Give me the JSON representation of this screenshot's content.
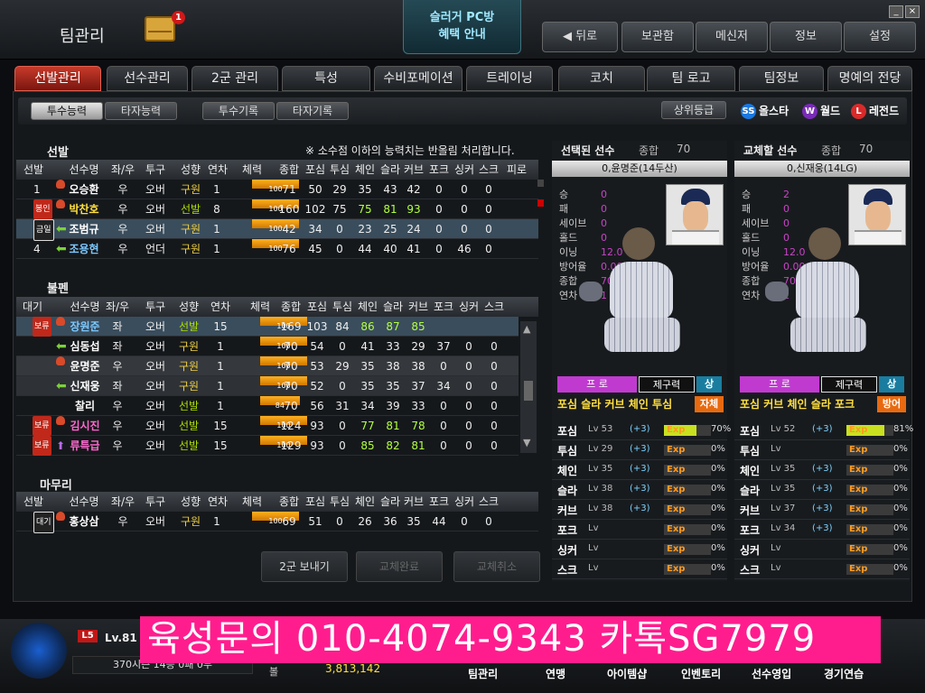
{
  "header": {
    "title": "팀관리",
    "mail_count": "1",
    "pcbang": [
      "슬러거 PC방",
      "혜택 안내"
    ],
    "nav": [
      "뒤로",
      "보관함",
      "메신저",
      "정보",
      "설정"
    ]
  },
  "tabs": [
    "선발관리",
    "선수관리",
    "2군 관리",
    "특성",
    "수비포메이션",
    "트레이닝",
    "코치",
    "팀 로고",
    "팀정보",
    "명예의 전당"
  ],
  "subtabs": [
    "투수능력",
    "타자능력",
    "투수기록",
    "타자기록"
  ],
  "grade": {
    "label": "상위등급",
    "items": [
      {
        "icon": "SS",
        "label": "올스타",
        "color": "#1a78e0"
      },
      {
        "icon": "W",
        "label": "월드",
        "color": "#7a2ab8"
      },
      {
        "icon": "L",
        "label": "레전드",
        "color": "#d82a2a"
      }
    ]
  },
  "notice": "※ 소수점 이하의 능력치는 반올림 처리합니다.",
  "sections": {
    "starter": "선발",
    "bullpen": "불펜",
    "closer": "마무리"
  },
  "starter_header": [
    "선발",
    "선수명",
    "좌/우",
    "투구",
    "성향",
    "연차",
    "체력",
    "종합",
    "포심",
    "투심",
    "체인",
    "슬라",
    "커브",
    "포크",
    "싱커",
    "스크",
    "피로"
  ],
  "starter_rows": [
    {
      "slot": "1",
      "name": "오승환",
      "hand": "우",
      "style": "오버",
      "type": "구원",
      "year": "1",
      "stamina": "100",
      "vals": [
        "71",
        "50",
        "29",
        "35",
        "43",
        "42",
        "0",
        "0",
        "0"
      ],
      "name_color": "#ffffff"
    },
    {
      "slot": "봉인",
      "name": "박찬호",
      "hand": "우",
      "style": "오버",
      "type": "선발",
      "year": "8",
      "stamina": "100",
      "vals": [
        "160",
        "102",
        "75",
        "75",
        "81",
        "93",
        "0",
        "0",
        "0"
      ],
      "name_color": "#ffe040"
    },
    {
      "slot": "금일",
      "name": "조범규",
      "hand": "우",
      "style": "오버",
      "type": "구원",
      "year": "1",
      "stamina": "100",
      "vals": [
        "42",
        "34",
        "0",
        "23",
        "25",
        "24",
        "0",
        "0",
        "0"
      ],
      "name_color": "#ffffff"
    },
    {
      "slot": "4",
      "name": "조용현",
      "hand": "우",
      "style": "언더",
      "type": "구원",
      "year": "1",
      "stamina": "100",
      "vals": [
        "76",
        "45",
        "0",
        "44",
        "40",
        "41",
        "0",
        "46",
        "0"
      ],
      "name_color": "#7cc8ff"
    }
  ],
  "bullpen_header": [
    "대기",
    "선수명",
    "좌/우",
    "투구",
    "성향",
    "연차",
    "체력",
    "종합",
    "포심",
    "투심",
    "체인",
    "슬라",
    "커브",
    "포크",
    "싱커",
    "스크"
  ],
  "bullpen_rows": [
    {
      "tag": "보류",
      "name": "장원준",
      "hand": "좌",
      "style": "오버",
      "type": "선발",
      "year": "15",
      "stamina": "100",
      "vals": [
        "169",
        "103",
        "84",
        "86",
        "87",
        "85",
        "",
        "",
        ""
      ],
      "name_color": "#7cc8ff"
    },
    {
      "tag": "",
      "name": "심동섭",
      "hand": "좌",
      "style": "오버",
      "type": "구원",
      "year": "1",
      "stamina": "100",
      "vals": [
        "70",
        "54",
        "0",
        "41",
        "33",
        "29",
        "37",
        "0",
        "0"
      ],
      "name_color": "#ffffff"
    },
    {
      "tag": "",
      "name": "윤명준",
      "hand": "우",
      "style": "오버",
      "type": "구원",
      "year": "1",
      "stamina": "100",
      "vals": [
        "70",
        "53",
        "29",
        "35",
        "38",
        "38",
        "0",
        "0",
        "0"
      ],
      "name_color": "#ffffff"
    },
    {
      "tag": "",
      "name": "신재웅",
      "hand": "좌",
      "style": "오버",
      "type": "구원",
      "year": "1",
      "stamina": "100",
      "vals": [
        "70",
        "52",
        "0",
        "35",
        "35",
        "37",
        "34",
        "0",
        "0"
      ],
      "name_color": "#ffffff"
    },
    {
      "tag": "",
      "name": "찰리",
      "hand": "우",
      "style": "오버",
      "type": "선발",
      "year": "1",
      "stamina": "84",
      "vals": [
        "70",
        "56",
        "31",
        "34",
        "39",
        "33",
        "0",
        "0",
        "0"
      ],
      "name_color": "#ffffff"
    },
    {
      "tag": "보류",
      "name": "김시진",
      "hand": "우",
      "style": "오버",
      "type": "선발",
      "year": "15",
      "stamina": "100",
      "vals": [
        "124",
        "93",
        "0",
        "77",
        "81",
        "78",
        "0",
        "0",
        "0"
      ],
      "name_color": "#ff6ad0"
    },
    {
      "tag": "보류",
      "name": "류특급",
      "hand": "우",
      "style": "오버",
      "type": "선발",
      "year": "15",
      "stamina": "100",
      "vals": [
        "129",
        "93",
        "0",
        "85",
        "82",
        "81",
        "0",
        "0",
        "0"
      ],
      "name_color": "#ff6ad0"
    }
  ],
  "closer_header": [
    "선발",
    "선수명",
    "좌/우",
    "투구",
    "성향",
    "연차",
    "체력",
    "종합",
    "포심",
    "투심",
    "체인",
    "슬라",
    "커브",
    "포크",
    "싱커",
    "스크"
  ],
  "closer_rows": [
    {
      "slot": "대기",
      "name": "홍상삼",
      "hand": "우",
      "style": "오버",
      "type": "구원",
      "year": "1",
      "stamina": "100",
      "vals": [
        "69",
        "51",
        "0",
        "26",
        "36",
        "35",
        "44",
        "0",
        "0"
      ],
      "name_color": "#ffffff"
    }
  ],
  "buttons": [
    "2군 보내기",
    "교체완료",
    "교체취소"
  ],
  "selected": {
    "title": "선택된 선수",
    "overall_label": "종합",
    "overall": "70",
    "name": "0,윤명준(14두산)",
    "stat_labels": [
      "승",
      "패",
      "세이브",
      "홀드",
      "이닝",
      "방어율",
      "종합",
      "연차"
    ],
    "stat_values": [
      "0",
      "0",
      "0",
      "0",
      "12.0",
      "0.00",
      "70",
      "1"
    ],
    "pro": "프 로",
    "control_label": "제구력",
    "control": "상",
    "pitches": "포심 슬라 커브 체인 투심",
    "style": "자체",
    "skills": [
      {
        "n": "포심",
        "lv": "Lv 53",
        "plus": "(+3)",
        "exp": "Exp",
        "pct": "70%",
        "fill": 0.7
      },
      {
        "n": "투심",
        "lv": "Lv 29",
        "plus": "(+3)",
        "exp": "Exp",
        "pct": "0%",
        "fill": 0
      },
      {
        "n": "체인",
        "lv": "Lv 35",
        "plus": "(+3)",
        "exp": "Exp",
        "pct": "0%",
        "fill": 0
      },
      {
        "n": "슬라",
        "lv": "Lv 38",
        "plus": "(+3)",
        "exp": "Exp",
        "pct": "0%",
        "fill": 0
      },
      {
        "n": "커브",
        "lv": "Lv 38",
        "plus": "(+3)",
        "exp": "Exp",
        "pct": "0%",
        "fill": 0
      },
      {
        "n": "포크",
        "lv": "Lv",
        "plus": "",
        "exp": "Exp",
        "pct": "0%",
        "fill": 0
      },
      {
        "n": "싱커",
        "lv": "Lv",
        "plus": "",
        "exp": "Exp",
        "pct": "0%",
        "fill": 0
      },
      {
        "n": "스크",
        "lv": "Lv",
        "plus": "",
        "exp": "Exp",
        "pct": "0%",
        "fill": 0
      }
    ]
  },
  "replace": {
    "title": "교체할 선수",
    "overall_label": "종합",
    "overall": "70",
    "name": "0,신재웅(14LG)",
    "stat_labels": [
      "승",
      "패",
      "세이브",
      "홀드",
      "이닝",
      "방어율",
      "종합",
      "연차"
    ],
    "stat_values": [
      "2",
      "0",
      "0",
      "0",
      "12.0",
      "0.00",
      "70",
      "1"
    ],
    "pro": "프 로",
    "control_label": "제구력",
    "control": "상",
    "pitches": "포심 커브 체인 슬라 포크",
    "style": "방어",
    "skills": [
      {
        "n": "포심",
        "lv": "Lv 52",
        "plus": "(+3)",
        "exp": "Exp",
        "pct": "81%",
        "fill": 0.81
      },
      {
        "n": "투심",
        "lv": "Lv",
        "plus": "",
        "exp": "Exp",
        "pct": "0%",
        "fill": 0
      },
      {
        "n": "체인",
        "lv": "Lv 35",
        "plus": "(+3)",
        "exp": "Exp",
        "pct": "0%",
        "fill": 0
      },
      {
        "n": "슬라",
        "lv": "Lv 35",
        "plus": "(+3)",
        "exp": "Exp",
        "pct": "0%",
        "fill": 0
      },
      {
        "n": "커브",
        "lv": "Lv 37",
        "plus": "(+3)",
        "exp": "Exp",
        "pct": "0%",
        "fill": 0
      },
      {
        "n": "포크",
        "lv": "Lv 34",
        "plus": "(+3)",
        "exp": "Exp",
        "pct": "0%",
        "fill": 0
      },
      {
        "n": "싱커",
        "lv": "Lv",
        "plus": "",
        "exp": "Exp",
        "pct": "0%",
        "fill": 0
      },
      {
        "n": "스크",
        "lv": "Lv",
        "plus": "",
        "exp": "Exp",
        "pct": "0%",
        "fill": 0
      }
    ]
  },
  "player": {
    "lv_badge": "L5",
    "lv": "Lv.81",
    "season": "370시즌  14승  0패  0무",
    "gold_label": "볼",
    "gold": "3,813,142"
  },
  "bottom_nav": [
    "팀관리",
    "연맹",
    "아이템샵",
    "인벤토리",
    "선수영입",
    "경기연습"
  ],
  "promo": "육성문의 010-4074-9343 카톡SG7979"
}
